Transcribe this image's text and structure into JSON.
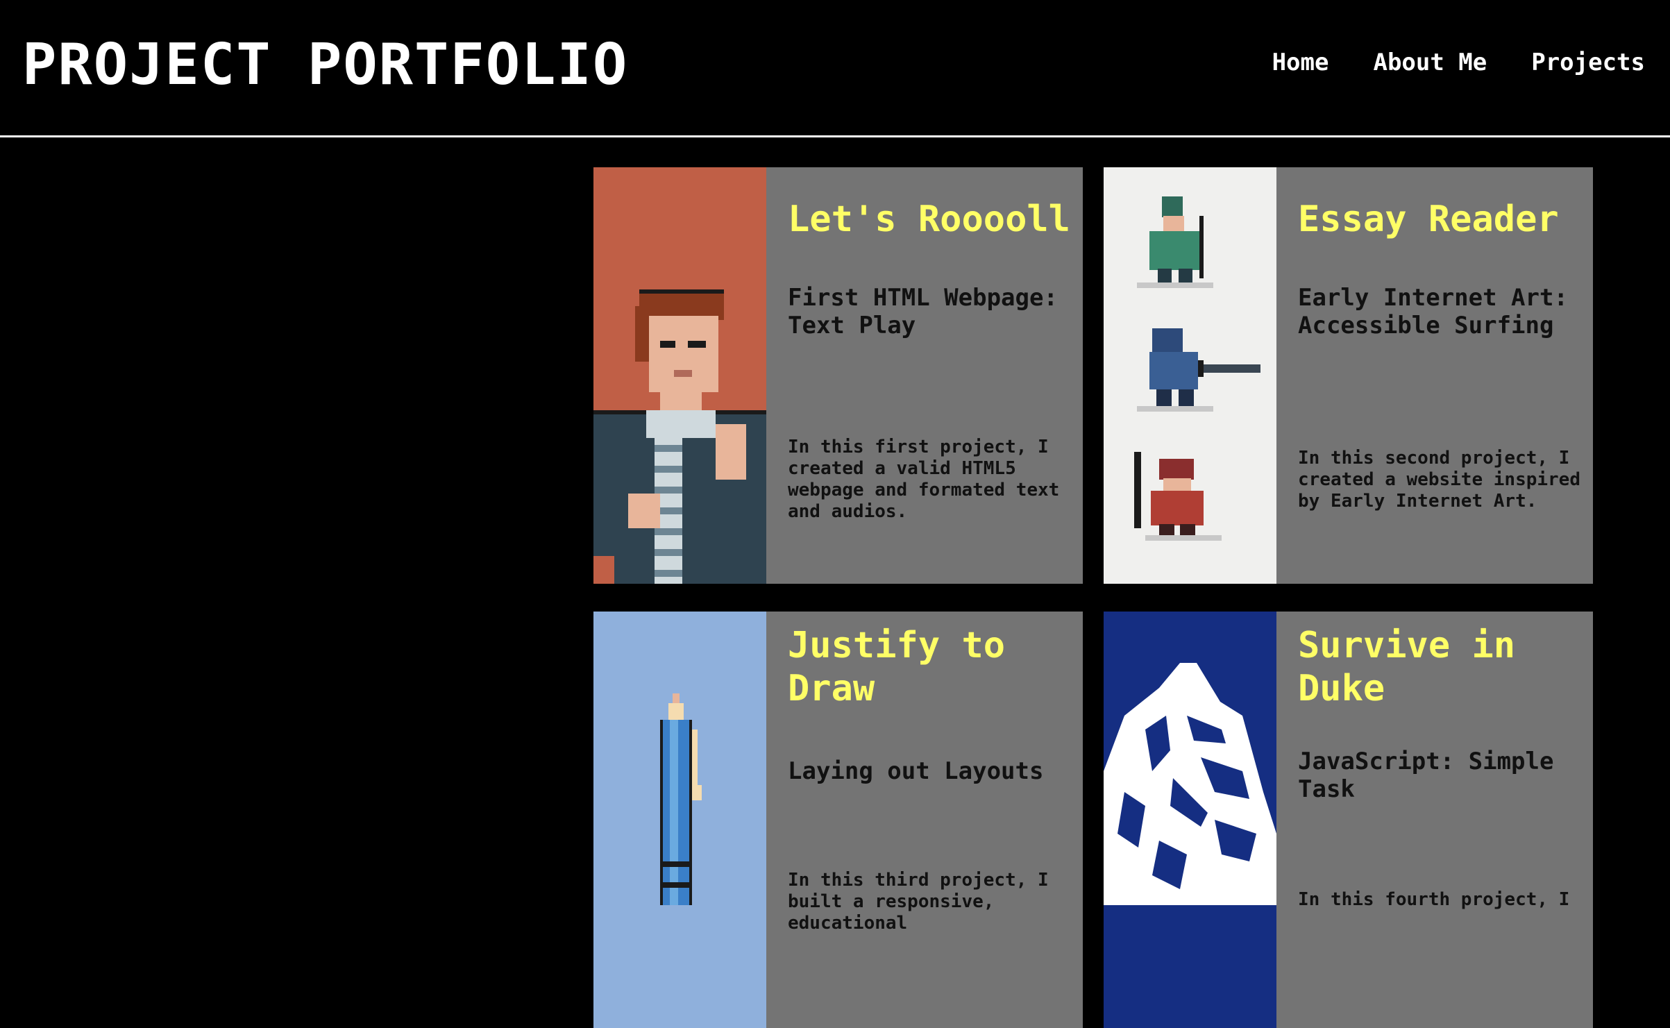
{
  "header": {
    "title": "PROJECT PORTFOLIO",
    "nav": [
      "Home",
      "About Me",
      "Projects"
    ]
  },
  "projects": [
    {
      "title": "Let's Rooooll",
      "subtitle": "First HTML Webpage: Text Play",
      "description": "In this first project, I created a valid HTML5 webpage and formated text and audios.",
      "art_bg": "#c05f46",
      "icon": "pixel-man-portrait"
    },
    {
      "title": "Essay Reader",
      "subtitle": "Early Internet Art: Accessible Surfing",
      "description": "In this second project, I created a website inspired by Early Internet Art.",
      "art_bg": "#f0f0ee",
      "icon": "pixel-warriors"
    },
    {
      "title": "Justify to Draw",
      "subtitle": "Laying out Layouts",
      "description": "In this third project, I built a responsive, educational",
      "art_bg": "#8fb0dc",
      "icon": "pixel-pencil"
    },
    {
      "title": "Survive in Duke",
      "subtitle": "JavaScript: Simple Task",
      "description": "In this fourth project, I",
      "art_bg": "#152e82",
      "icon": "duke-blue-devil"
    }
  ],
  "colors": {
    "background": "#000000",
    "card_info_bg": "#747474",
    "title_yellow": "#ffff66",
    "text_dark": "#111111"
  }
}
